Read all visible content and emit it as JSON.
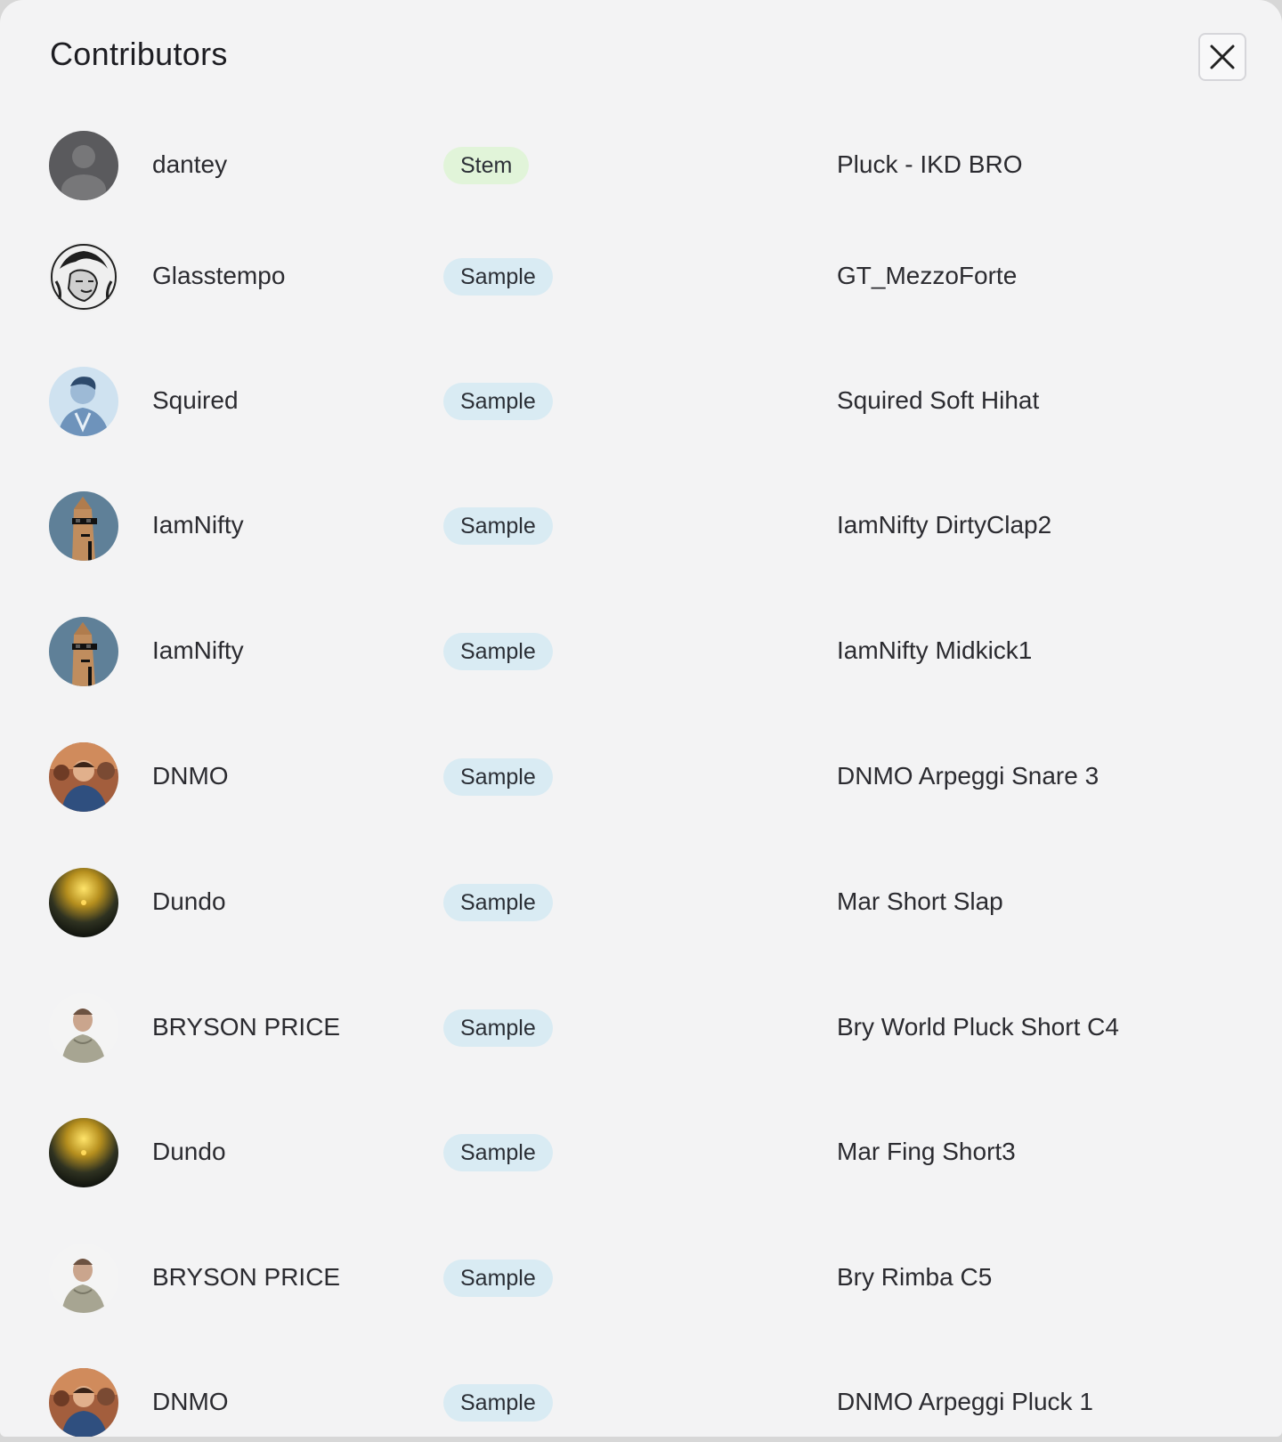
{
  "modal": {
    "title": "Contributors",
    "close_icon": "close-icon"
  },
  "contributors": [
    {
      "name": "dantey",
      "type": "Stem",
      "track": "Pluck - IKD BRO",
      "avatar": "default-user-icon"
    },
    {
      "name": "Glasstempo",
      "type": "Sample",
      "track": "GT_MezzoForte",
      "avatar": "statue-avatar"
    },
    {
      "name": "Squired",
      "type": "Sample",
      "track": "Squired Soft Hihat",
      "avatar": "portrait-avatar"
    },
    {
      "name": "IamNifty",
      "type": "Sample",
      "track": "IamNifty DirtyClap2",
      "avatar": "pixel-punk-avatar"
    },
    {
      "name": "IamNifty",
      "type": "Sample",
      "track": "IamNifty Midkick1",
      "avatar": "pixel-punk-avatar"
    },
    {
      "name": "DNMO",
      "type": "Sample",
      "track": "DNMO Arpeggi Snare 3",
      "avatar": "crowd-photo-avatar"
    },
    {
      "name": "Dundo",
      "type": "Sample",
      "track": "Mar Short Slap",
      "avatar": "orb-avatar"
    },
    {
      "name": "BRYSON PRICE",
      "type": "Sample",
      "track": "Bry World Pluck Short C4",
      "avatar": "person-photo-avatar"
    },
    {
      "name": "Dundo",
      "type": "Sample",
      "track": "Mar Fing Short3",
      "avatar": "orb-avatar"
    },
    {
      "name": "BRYSON PRICE",
      "type": "Sample",
      "track": "Bry Rimba C5",
      "avatar": "person-photo-avatar"
    },
    {
      "name": "DNMO",
      "type": "Sample",
      "track": "DNMO Arpeggi Pluck 1",
      "avatar": "crowd-photo-avatar"
    }
  ]
}
